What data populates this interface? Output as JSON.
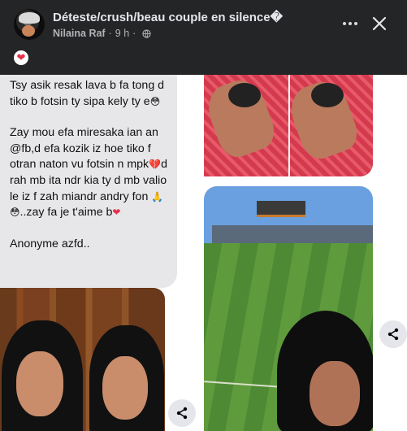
{
  "header": {
    "title": "Déteste/crush/beau couple en silence�",
    "author": "Nilaina Raf",
    "time": "9 h",
    "separator": "·",
    "reaction": "❤"
  },
  "message": {
    "paragraph1": "Tsy asik resak lava b fa tong d tiko b fotsin ty sipa kely ty e",
    "paragraph1_emoji": "😳",
    "paragraph2_a": "Zay mou efa miresaka ian an @fb,d efa kozik iz hoe tiko f otran naton vu fotsin n mpk",
    "emoji_broken_heart": "💔",
    "paragraph2_b": "d rah mb ita ndr kia ty d mb valio le iz f zah miandr andry fon",
    "emoji_pray": "🙏",
    "emoji_flushed": "😳",
    "paragraph2_c": "..zay fa je t'aime b",
    "emoji_heart": "❤",
    "paragraph3": "Anonyme azfd.."
  },
  "icons": {
    "more": "more-options-icon",
    "close": "close-icon",
    "share": "share-icon",
    "globe": "globe-icon"
  }
}
